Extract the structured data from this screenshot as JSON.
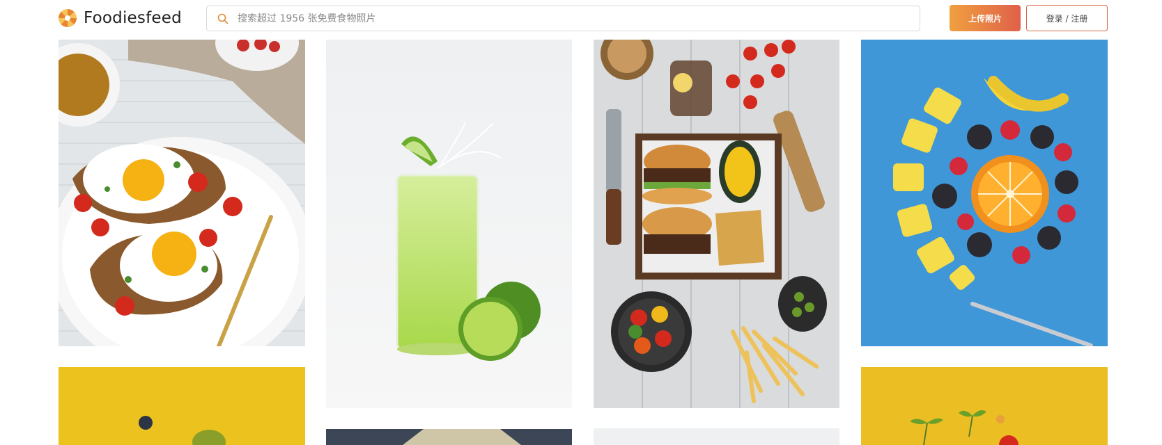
{
  "header": {
    "logo_text": "Foodiesfeed",
    "search_placeholder": "搜索超过 1956 张免费食物照片",
    "upload_label": "上传照片",
    "login_label": "登录 / 注册"
  },
  "colors": {
    "accent_start": "#f0a040",
    "accent_end": "#e0604a",
    "login_border": "#d66a4a"
  },
  "photos": [
    {
      "subject": "eggs-avocado-toast"
    },
    {
      "subject": "lime-juice-splash"
    },
    {
      "subject": "burger-fries-platter"
    },
    {
      "subject": "orange-berries-banana-blue"
    },
    {
      "subject": "yellow-background-fruit"
    },
    {
      "subject": "dark-stone-food"
    },
    {
      "subject": "white-food"
    },
    {
      "subject": "yellow-background-sprouts"
    }
  ]
}
